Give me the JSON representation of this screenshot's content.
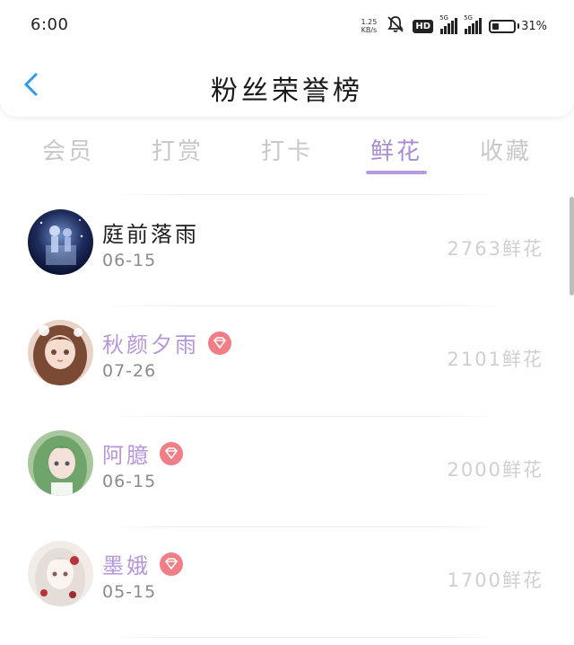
{
  "status_bar": {
    "time": "6:00",
    "net_speed_value": "1.25",
    "net_speed_unit": "KB/s",
    "hd_label": "HD",
    "network_1": "5G",
    "network_2": "5G",
    "battery_percent": "31",
    "battery_unit": "%",
    "battery_level": 0.31,
    "icons": [
      "bell-muted-icon",
      "hd-voice-icon",
      "signal-icon",
      "battery-icon"
    ]
  },
  "header": {
    "title": "粉丝荣誉榜",
    "back_icon": "chevron-left-icon",
    "accent_color": "#2b9bf0"
  },
  "tabs": [
    {
      "label": "会员",
      "active": false
    },
    {
      "label": "打赏",
      "active": false
    },
    {
      "label": "打卡",
      "active": false
    },
    {
      "label": "鲜花",
      "active": true
    },
    {
      "label": "收藏",
      "active": false
    }
  ],
  "colors": {
    "tab_active": "#a98bd2",
    "tab_inactive": "#c8c8c8",
    "vip_name": "#b596da",
    "vip_badge": "#f07e86"
  },
  "list": [
    {
      "name": "庭前落雨",
      "date": "06-15",
      "count": "2763鲜花",
      "vip": false,
      "avatar": "avatar-night-scene"
    },
    {
      "name": "秋颜夕雨",
      "date": "07-26",
      "count": "2101鲜花",
      "vip": true,
      "avatar": "avatar-girl-brown-hair"
    },
    {
      "name": "阿臆",
      "date": "06-15",
      "count": "2000鲜花",
      "vip": true,
      "avatar": "avatar-girl-green-hair"
    },
    {
      "name": "墨娥",
      "date": "05-15",
      "count": "1700鲜花",
      "vip": true,
      "avatar": "avatar-girl-white-hair"
    }
  ]
}
